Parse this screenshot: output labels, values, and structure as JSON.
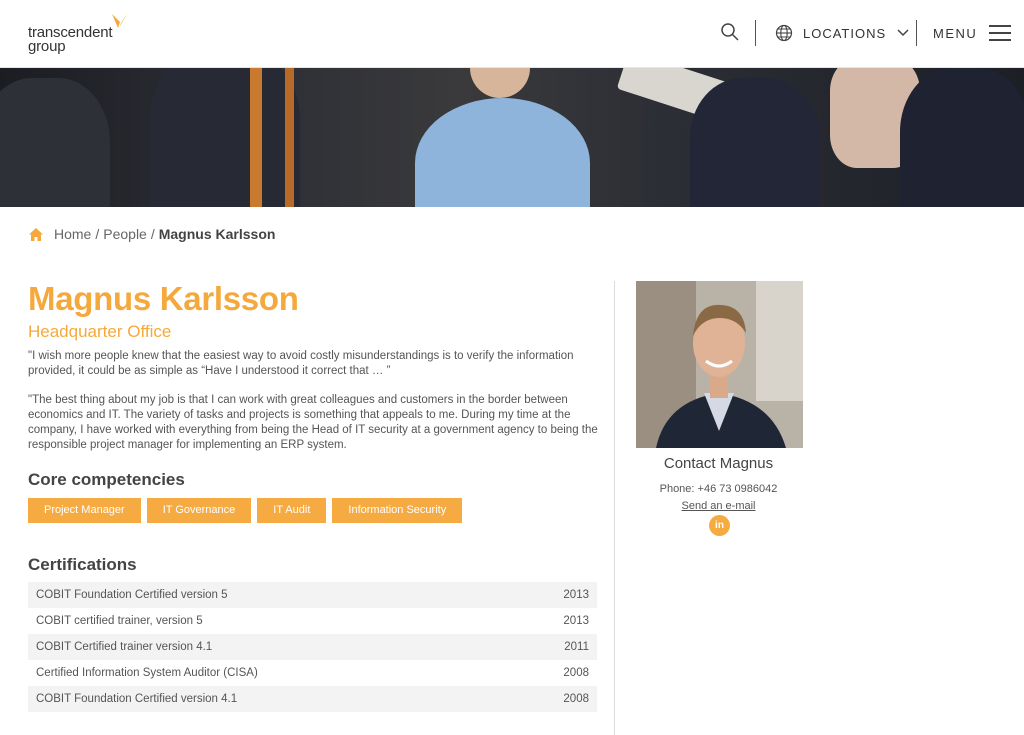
{
  "brand": {
    "logo_line1": "transcendent",
    "logo_line2": "group",
    "accent_color": "#f5a93c"
  },
  "header": {
    "locations_label": "LOCATIONS",
    "menu_label": "MENU"
  },
  "breadcrumb": {
    "home": "Home",
    "people": "People",
    "current": "Magnus Karlsson",
    "sep": "/"
  },
  "person": {
    "name": "Magnus Karlsson",
    "office": "Headquarter Office",
    "quote": "\"I wish more people knew that the easiest way to avoid costly misunderstandings is to verify the information provided, it could be as simple as “Have I understood it correct that … ”",
    "bio": "\"The best thing about my job is that I can work with great colleagues and customers in the border between economics and IT. The variety of tasks and projects is something that appeals to me. During my time at the company, I have worked with everything from being the Head of IT security at a government agency to being the responsible project manager for implementing an ERP system."
  },
  "competencies": {
    "heading": "Core competencies",
    "items": [
      "Project Manager",
      "IT Governance",
      "IT Audit",
      "Information Security"
    ]
  },
  "certifications": {
    "heading": "Certifications",
    "rows": [
      {
        "name": "COBIT Foundation Certified version 5",
        "year": "2013"
      },
      {
        "name": "COBIT certified trainer, version 5",
        "year": "2013"
      },
      {
        "name": "COBIT Certified trainer version 4.1",
        "year": "2011"
      },
      {
        "name": "Certified Information System Auditor (CISA)",
        "year": "2008"
      },
      {
        "name": "COBIT Foundation Certified version 4.1",
        "year": "2008"
      }
    ]
  },
  "contact": {
    "title": "Contact Magnus",
    "phone": "Phone: +46 73 0986042",
    "email_label": "Send an e-mail",
    "linkedin_label": "in"
  },
  "icons": [
    "butterfly-logo-icon",
    "search-icon",
    "globe-icon",
    "chevron-down-icon",
    "hamburger-menu-icon",
    "home-icon",
    "linkedin-icon"
  ]
}
